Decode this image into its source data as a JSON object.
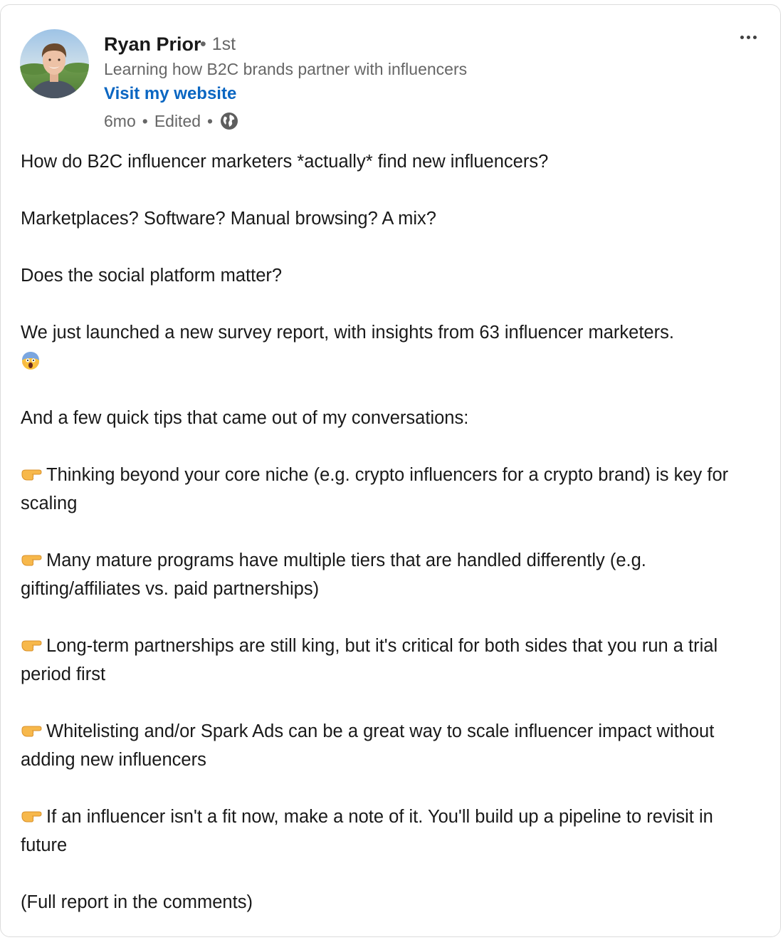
{
  "author": {
    "name": "Ryan Prior",
    "degree_sep": "•",
    "degree": "1st",
    "headline": "Learning how B2C brands partner with influencers",
    "website_link": "Visit my website"
  },
  "meta": {
    "time": "6mo",
    "sep1": "•",
    "edited": "Edited",
    "sep2": "•",
    "visibility_icon": "globe-icon"
  },
  "post": {
    "line1": "How do B2C influencer marketers *actually* find new influencers?",
    "line2": "Marketplaces? Software? Manual browsing? A mix?",
    "line3": "Does the social platform matter?",
    "line4": "We just launched a new survey report, with insights from 63 influencer marketers.",
    "line4_emoji": "face-screaming-in-fear-icon",
    "line5": "And a few quick tips that came out of my conversations:",
    "tips": [
      "Thinking beyond your core niche (e.g. crypto influencers for a crypto brand) is key for scaling",
      "Many mature programs have multiple tiers that are handled differently (e.g. gifting/affiliates vs. paid partnerships)",
      "Long-term partnerships are still king, but it's critical for both sides that you run a trial period first",
      "Whitelisting and/or Spark Ads can be a great way to scale influencer impact without adding new influencers",
      "If an influencer isn't a fit now, make a note of it. You'll build up a pipeline to revisit in future"
    ],
    "tip_icon": "backhand-index-pointing-right-icon",
    "closing": "(Full report in the comments)"
  },
  "colors": {
    "link": "#0a66c2",
    "secondary_text": "#666666",
    "primary_text": "#191919"
  }
}
